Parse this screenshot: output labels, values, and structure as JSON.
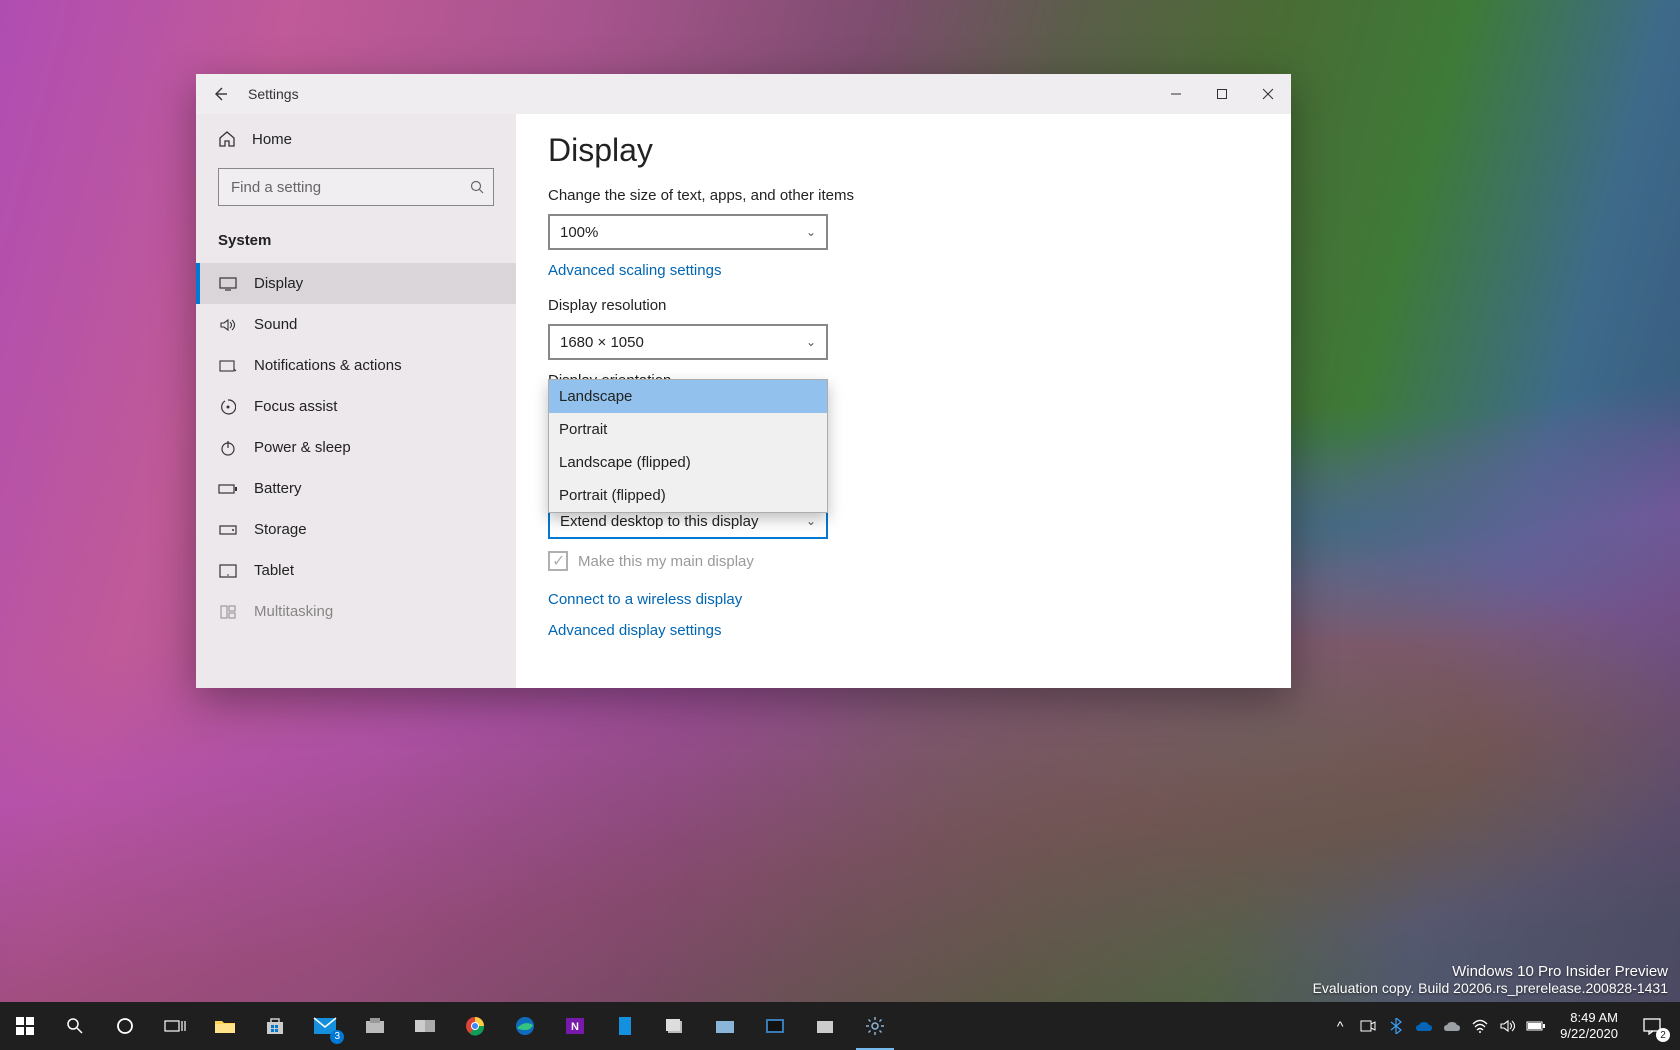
{
  "window": {
    "title": "Settings",
    "home_label": "Home",
    "search_placeholder": "Find a setting",
    "group_label": "System"
  },
  "sidebar": {
    "items": [
      {
        "label": "Display"
      },
      {
        "label": "Sound"
      },
      {
        "label": "Notifications & actions"
      },
      {
        "label": "Focus assist"
      },
      {
        "label": "Power & sleep"
      },
      {
        "label": "Battery"
      },
      {
        "label": "Storage"
      },
      {
        "label": "Tablet"
      },
      {
        "label": "Multitasking"
      }
    ]
  },
  "page": {
    "heading": "Display",
    "scale_label": "Change the size of text, apps, and other items",
    "scale_value": "100%",
    "advanced_scaling": "Advanced scaling settings",
    "resolution_label": "Display resolution",
    "resolution_value": "1680 × 1050",
    "orientation_label": "Display orientation",
    "orientation_options": {
      "o1": "Landscape",
      "o2": "Portrait",
      "o3": "Landscape (flipped)",
      "o4": "Portrait (flipped)"
    },
    "multiple_value": "Extend desktop to this display",
    "main_display_label": "Make this my main display",
    "wireless_link": "Connect to a wireless display",
    "advanced_link": "Advanced display settings"
  },
  "watermark": {
    "l1": "Windows 10 Pro Insider Preview",
    "l2": "Evaluation copy. Build 20206.rs_prerelease.200828-1431"
  },
  "taskbar": {
    "mail_badge": "3",
    "time": "8:49 AM",
    "date": "9/22/2020",
    "notif_count": "2"
  }
}
